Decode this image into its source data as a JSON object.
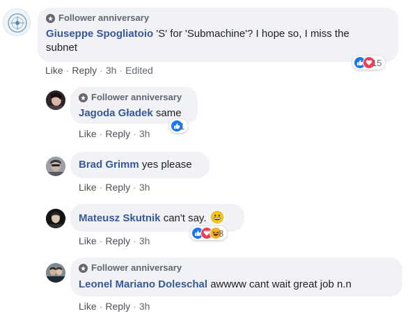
{
  "actions": {
    "like": "Like",
    "reply": "Reply",
    "separator": "·"
  },
  "comments": [
    {
      "badge": "Follower anniversary",
      "author": "Giuseppe Spogliatoio",
      "text": "'S' for 'Submachine'? I hope so, I miss the subnet",
      "time": "3h",
      "edited": "Edited",
      "reaction_count": "15",
      "reactions": [
        "like-icon",
        "love-icon"
      ]
    },
    {
      "badge": "Follower anniversary",
      "author": "Jagoda Gładek",
      "text": "same",
      "time": "3h",
      "reaction_count": "1",
      "reactions": [
        "like-icon"
      ]
    },
    {
      "author": "Brad Grimm",
      "text": "yes please",
      "time": "3h"
    },
    {
      "author": "Mateusz Skutnik",
      "text": "can't say.",
      "emoji": "grinning-face-emoji",
      "time": "3h",
      "reaction_count": "8",
      "reactions": [
        "like-icon",
        "love-icon",
        "haha-icon"
      ]
    },
    {
      "badge": "Follower anniversary",
      "author": "Leonel Mariano Doleschal",
      "text": "awwww cant wait great job n.n",
      "time": "3h"
    }
  ],
  "colors": {
    "author": "#385898",
    "bubble": "#f0f2f5",
    "like": "#1877f2",
    "love": "#f33e58",
    "haha": "#f7b125"
  }
}
